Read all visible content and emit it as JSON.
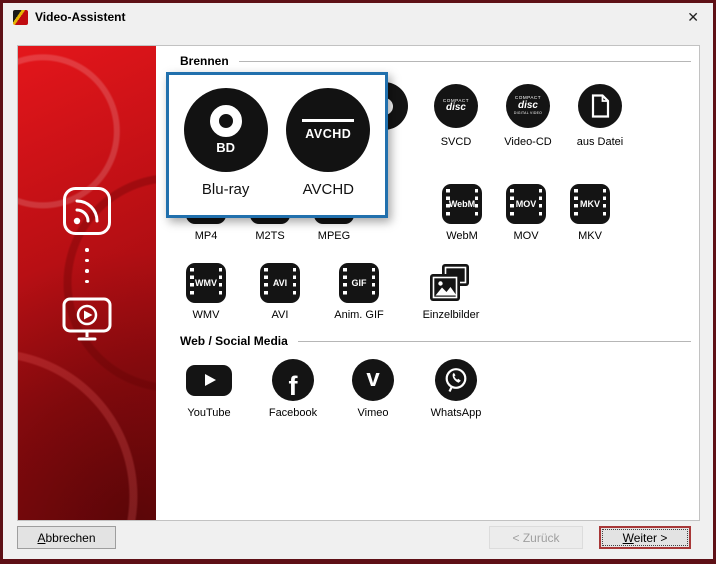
{
  "window": {
    "title": "Video-Assistent",
    "close_glyph": "✕"
  },
  "sections": {
    "burn": "Brennen",
    "web": "Web / Social Media"
  },
  "overlay": {
    "bluray": {
      "label": "Blu-ray",
      "badge": "BD"
    },
    "avchd": {
      "label": "AVCHD",
      "badge": "AVCHD"
    }
  },
  "burn_row": [
    {
      "label": ""
    },
    {
      "label": ""
    },
    {
      "label": ""
    },
    {
      "label": "SVCD",
      "disc_line1": "COMPACT",
      "disc_line2": "disc"
    },
    {
      "label": "Video-CD",
      "disc_line1": "COMPACT",
      "disc_line2": "disc",
      "disc_line3": "DIGITAL VIDEO"
    },
    {
      "label": "aus Datei"
    }
  ],
  "format_row1": [
    {
      "icon_text": "MP4",
      "label": "MP4"
    },
    {
      "icon_text": "M2TS",
      "label": "M2TS"
    },
    {
      "icon_text": "MPEG",
      "label": "MPEG"
    },
    {
      "icon_text": "WebM",
      "label": "WebM"
    },
    {
      "icon_text": "MOV",
      "label": "MOV"
    },
    {
      "icon_text": "MKV",
      "label": "MKV"
    }
  ],
  "format_row2": [
    {
      "icon_text": "WMV",
      "label": "WMV"
    },
    {
      "icon_text": "AVI",
      "label": "AVI"
    },
    {
      "icon_text": "GIF",
      "label": "Anim. GIF"
    },
    {
      "label": "Einzelbilder"
    }
  ],
  "social_row": [
    {
      "label": "YouTube"
    },
    {
      "label": "Facebook"
    },
    {
      "label": "Vimeo"
    },
    {
      "label": "WhatsApp"
    }
  ],
  "footer": {
    "cancel_mnemonic": "A",
    "cancel_rest": "bbrechen",
    "back_label": "< Zurück",
    "next_mnemonic": "W",
    "next_rest": "eiter >"
  }
}
